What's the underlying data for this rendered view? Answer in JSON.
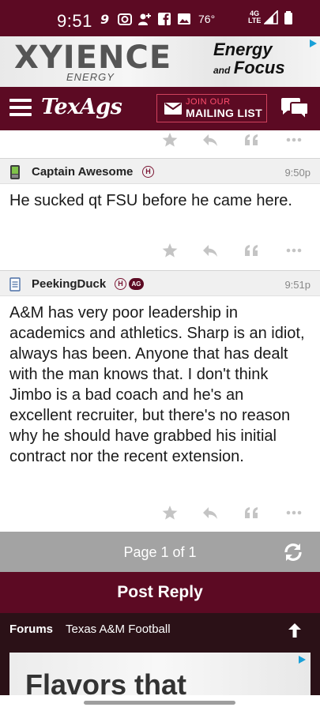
{
  "status_bar": {
    "time": "9:51",
    "temperature": "76°",
    "network": [
      "4G",
      "LTE"
    ],
    "icons": [
      "nine-app-icon",
      "camera-icon",
      "add-person-icon",
      "facebook-icon",
      "image-icon",
      "signal-icon",
      "battery-icon"
    ]
  },
  "ad_top": {
    "brand": "XYIENCE",
    "brand_sub": "ENERGY",
    "tagline_1": "Energy",
    "tagline_and": "and",
    "tagline_2": "Focus"
  },
  "header": {
    "logo": "TexAgs",
    "join_small": "JOIN OUR",
    "join_big": "MAILING LIST"
  },
  "posts": [
    {
      "user": "Captain Awesome",
      "badges": [
        "H"
      ],
      "time": "9:50p",
      "body": "He sucked qt FSU before he came here."
    },
    {
      "user": "PeekingDuck",
      "badges": [
        "H",
        "AG"
      ],
      "time": "9:51p",
      "body": "A&M has very poor leadership in academics and athletics. Sharp is an idiot, always has been. Anyone that has dealt with the man knows that. I don't think Jimbo is a bad coach and he's an excellent recruiter, but there's no reason why he should have grabbed his initial contract nor the recent extension."
    }
  ],
  "pager": {
    "text": "Page 1 of 1"
  },
  "post_reply": {
    "label": "Post Reply"
  },
  "breadcrumb": {
    "forums": "Forums",
    "board": "Texas A&M Football"
  },
  "ad_bottom": {
    "text": "Flavors that"
  },
  "colors": {
    "maroon": "#5c0a23",
    "pager_gray": "#a3a3a3",
    "breadcrumb_bg": "#2b1117"
  }
}
